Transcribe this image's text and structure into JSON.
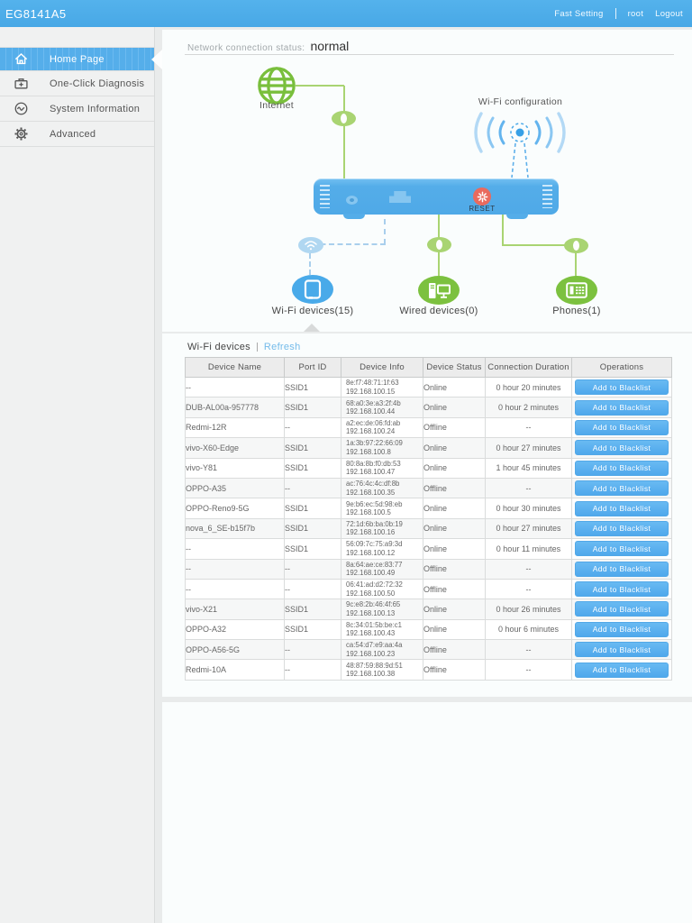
{
  "header": {
    "title": "EG8141A5",
    "fast_setting": "Fast Setting",
    "user": "root",
    "logout": "Logout"
  },
  "sidebar": {
    "items": [
      {
        "label": "Home Page"
      },
      {
        "label": "One-Click Diagnosis"
      },
      {
        "label": "System Information"
      },
      {
        "label": "Advanced"
      }
    ]
  },
  "status": {
    "label": "Network connection status:",
    "value": "normal"
  },
  "diagram": {
    "internet_label": "Internet",
    "wifi_config_label": "Wi-Fi configuration",
    "reset_label": "RESET",
    "wifi_devices_label": "Wi-Fi devices(15)",
    "wired_devices_label": "Wired devices(0)",
    "phones_label": "Phones(1)"
  },
  "device_table": {
    "title": "Wi-Fi devices",
    "refresh_label": "Refresh",
    "columns": [
      "Device Name",
      "Port ID",
      "Device Info",
      "Device Status",
      "Connection Duration",
      "Operations"
    ],
    "button_label": "Add to Blacklist",
    "rows": [
      {
        "name": "--",
        "port": "SSID1",
        "mac": "8e:f7:48:71:1f:63",
        "ip": "192.168.100.15",
        "status": "Online",
        "duration": "0 hour 20 minutes"
      },
      {
        "name": "DUB-AL00a-957778",
        "port": "SSID1",
        "mac": "68:a0:3e:a3:2f:4b",
        "ip": "192.168.100.44",
        "status": "Online",
        "duration": "0 hour 2 minutes"
      },
      {
        "name": "Redmi-12R",
        "port": "--",
        "mac": "a2:ec:de:06:fd:ab",
        "ip": "192.168.100.24",
        "status": "Offline",
        "duration": "--"
      },
      {
        "name": "vivo-X60-Edge",
        "port": "SSID1",
        "mac": "1a:3b:97:22:66:09",
        "ip": "192.168.100.8",
        "status": "Online",
        "duration": "0 hour 27 minutes"
      },
      {
        "name": "vivo-Y81",
        "port": "SSID1",
        "mac": "80:8a:8b:f0:db:53",
        "ip": "192.168.100.47",
        "status": "Online",
        "duration": "1 hour 45 minutes"
      },
      {
        "name": "OPPO-A35",
        "port": "--",
        "mac": "ac:76:4c:4c:df:8b",
        "ip": "192.168.100.35",
        "status": "Offline",
        "duration": "--"
      },
      {
        "name": "OPPO-Reno9-5G",
        "port": "SSID1",
        "mac": "9e:b6:ec:5d:98:eb",
        "ip": "192.168.100.5",
        "status": "Online",
        "duration": "0 hour 30 minutes"
      },
      {
        "name": "nova_6_SE-b15f7b",
        "port": "SSID1",
        "mac": "72:1d:6b:ba:0b:19",
        "ip": "192.168.100.16",
        "status": "Online",
        "duration": "0 hour 27 minutes"
      },
      {
        "name": "--",
        "port": "SSID1",
        "mac": "56:09:7c:75:a9:3d",
        "ip": "192.168.100.12",
        "status": "Online",
        "duration": "0 hour 11 minutes"
      },
      {
        "name": "--",
        "port": "--",
        "mac": "8a:64:ae:ce:83:77",
        "ip": "192.168.100.49",
        "status": "Offline",
        "duration": "--"
      },
      {
        "name": "--",
        "port": "--",
        "mac": "06:41:ad:d2:72:32",
        "ip": "192.168.100.50",
        "status": "Offline",
        "duration": "--"
      },
      {
        "name": "vivo-X21",
        "port": "SSID1",
        "mac": "9c:e8:2b:46:4f:65",
        "ip": "192.168.100.13",
        "status": "Online",
        "duration": "0 hour 26 minutes"
      },
      {
        "name": "OPPO-A32",
        "port": "SSID1",
        "mac": "8c:34:01:5b:be:c1",
        "ip": "192.168.100.43",
        "status": "Online",
        "duration": "0 hour 6 minutes"
      },
      {
        "name": "OPPO-A56-5G",
        "port": "--",
        "mac": "ca:54:d7:e9:aa:4a",
        "ip": "192.168.100.23",
        "status": "Offline",
        "duration": "--"
      },
      {
        "name": "Redmi-10A",
        "port": "--",
        "mac": "48:87:59:88:9d:51",
        "ip": "192.168.100.38",
        "status": "Offline",
        "duration": "--"
      }
    ]
  },
  "colors": {
    "accent_blue": "#4FACE9",
    "green": "#7CC13F",
    "button_blue": "#58AEED",
    "reset_red": "#E96A5E"
  }
}
